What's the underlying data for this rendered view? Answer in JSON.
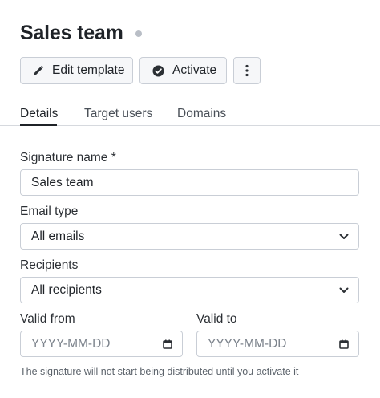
{
  "header": {
    "title": "Sales team"
  },
  "toolbar": {
    "edit_label": "Edit template",
    "activate_label": "Activate",
    "more_label": "⋮"
  },
  "tabs": [
    {
      "label": "Details",
      "active": true
    },
    {
      "label": "Target users",
      "active": false
    },
    {
      "label": "Domains",
      "active": false
    }
  ],
  "form": {
    "signature_name": {
      "label": "Signature name",
      "required_marker": "*",
      "value": "Sales team"
    },
    "email_type": {
      "label": "Email type",
      "value": "All emails"
    },
    "recipients": {
      "label": "Recipients",
      "value": "All recipients"
    },
    "valid_from": {
      "label": "Valid from",
      "placeholder": "YYYY-MM-DD"
    },
    "valid_to": {
      "label": "Valid to",
      "placeholder": "YYYY-MM-DD"
    },
    "hint": "The signature will not start being distributed until you activate it"
  },
  "icons": {
    "edit": "pencil-icon",
    "activate": "check-circle-icon",
    "more": "kebab-menu-icon",
    "select": "chevron-down-icon",
    "date": "calendar-icon"
  },
  "colors": {
    "status_dot": "#b9bec6",
    "border": "#c9ced6",
    "text": "#1f2328"
  }
}
